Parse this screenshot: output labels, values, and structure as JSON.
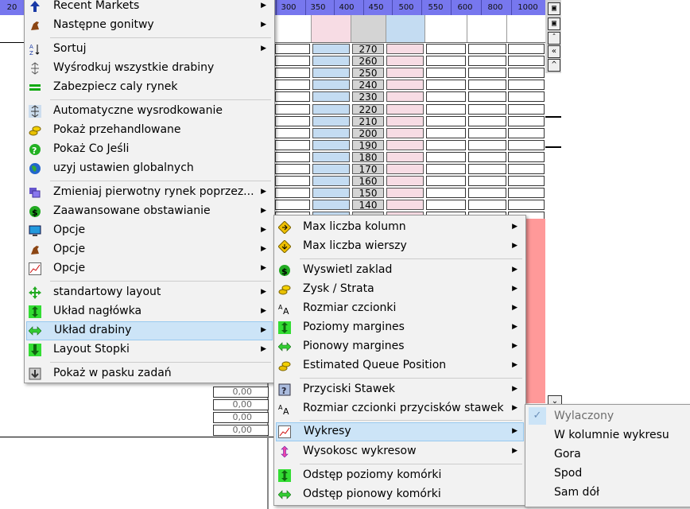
{
  "ladder": {
    "left_col_label": "20",
    "columns": [
      "300",
      "350",
      "400",
      "450",
      "500",
      "550",
      "600",
      "800",
      "1000"
    ],
    "prices": [
      "270",
      "260",
      "250",
      "240",
      "230",
      "220",
      "210",
      "200",
      "190",
      "180",
      "170",
      "160",
      "150",
      "140"
    ],
    "zero_values": [
      "0,00",
      "0,00",
      "0,00",
      "0,00"
    ]
  },
  "menu_main": {
    "items": [
      {
        "label": "Recent Markets",
        "icon": "up-arrow-icon",
        "submenu": true
      },
      {
        "label": "Następne gonitwy",
        "icon": "horse-icon",
        "submenu": true
      },
      {
        "label": "Sortuj",
        "icon": "sort-az-icon",
        "submenu": true
      },
      {
        "label": "Wyśrodkuj wszystkie drabiny",
        "icon": "center-arrows-icon",
        "submenu": false
      },
      {
        "label": "Zabezpiecz caly rynek",
        "icon": "green-bars-icon",
        "submenu": false
      },
      {
        "label": "Automatyczne wysrodkowanie",
        "icon": "auto-center-icon",
        "submenu": false
      },
      {
        "label": "Pokaż przehandlowane",
        "icon": "coins-icon",
        "submenu": false
      },
      {
        "label": "Pokaż Co Jeśli",
        "icon": "question-icon",
        "submenu": false
      },
      {
        "label": "uzyj ustawien globalnych",
        "icon": "globe-icon",
        "submenu": false
      },
      {
        "label": "Zmieniaj pierwotny rynek poprzez...",
        "icon": "windows-icon",
        "submenu": true
      },
      {
        "label": "Zaawansowane obstawianie",
        "icon": "dollar-icon",
        "submenu": true
      },
      {
        "label": "Opcje",
        "icon": "monitor-icon",
        "submenu": true
      },
      {
        "label": "Opcje",
        "icon": "horse-icon",
        "submenu": true
      },
      {
        "label": "Opcje",
        "icon": "chart-icon",
        "submenu": true
      },
      {
        "label": "standartowy layout",
        "icon": "move-arrows-icon",
        "submenu": true
      },
      {
        "label": "Układ nagłówka",
        "icon": "vertical-arrows-icon",
        "submenu": true
      },
      {
        "label": "Układ drabiny",
        "icon": "horizontal-arrows-icon",
        "submenu": true,
        "highlighted": true
      },
      {
        "label": "Layout Stopki",
        "icon": "down-arrows-icon",
        "submenu": true
      },
      {
        "label": "Pokaż w pasku zadań",
        "icon": "taskbar-icon",
        "submenu": false
      }
    ]
  },
  "menu_sub": {
    "items": [
      {
        "label": "Max liczba kolumn",
        "icon": "diamond-right-icon",
        "submenu": true
      },
      {
        "label": "Max liczba wierszy",
        "icon": "diamond-down-icon",
        "submenu": true
      },
      {
        "label": "Wyswietl zaklad",
        "icon": "dollar-icon",
        "submenu": true
      },
      {
        "label": "Zysk / Strata",
        "icon": "coins-icon",
        "submenu": true
      },
      {
        "label": "Rozmiar czcionki",
        "icon": "font-size-icon",
        "submenu": true
      },
      {
        "label": "Poziomy margines",
        "icon": "vertical-arrows-icon",
        "submenu": true
      },
      {
        "label": "Pionowy margines",
        "icon": "horizontal-arrows-icon",
        "submenu": true
      },
      {
        "label": "Estimated Queue Position",
        "icon": "coins-icon",
        "submenu": true
      },
      {
        "label": "Przyciski Stawek",
        "icon": "question-box-icon",
        "submenu": true
      },
      {
        "label": "Rozmiar czcionki przycisków stawek",
        "icon": "font-size-icon",
        "submenu": true
      },
      {
        "label": "Wykresy",
        "icon": "chart-icon",
        "submenu": true,
        "highlighted": true
      },
      {
        "label": "Wysokosc wykresow",
        "icon": "pink-vertical-arrows-icon",
        "submenu": true
      },
      {
        "label": "Odstęp poziomy komórki",
        "icon": "vertical-arrows-icon",
        "submenu": false
      },
      {
        "label": "Odstęp pionowy komórki",
        "icon": "horizontal-arrows-icon",
        "submenu": false
      }
    ]
  },
  "menu_charts": {
    "items": [
      {
        "label": "Wylaczony",
        "checked": true,
        "disabled": true
      },
      {
        "label": "W kolumnie wykresu",
        "checked": false
      },
      {
        "label": "Gora",
        "checked": false
      },
      {
        "label": "Spod",
        "checked": false
      },
      {
        "label": "Sam dół",
        "checked": false
      }
    ]
  },
  "colors": {
    "menu_bg": "#f2f2f2",
    "highlight": "#cce4f7",
    "ladder_top": "#7777ee",
    "blue_cell": "#c4dcf2",
    "pink_cell": "#f7dce4"
  }
}
